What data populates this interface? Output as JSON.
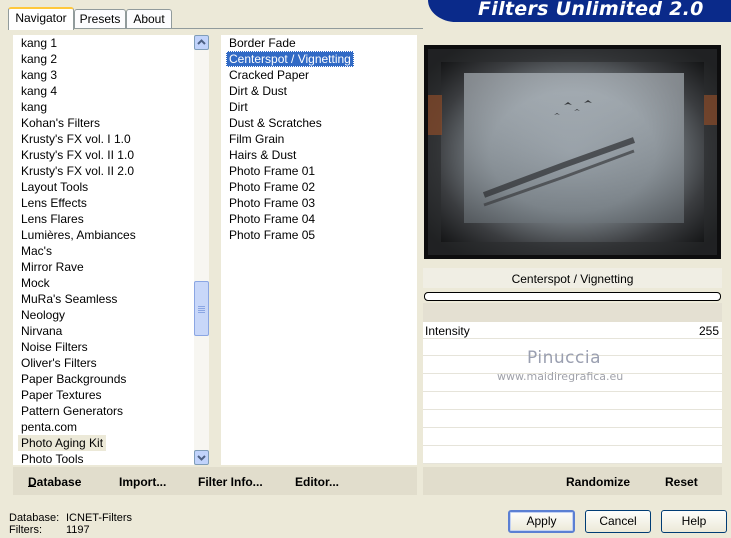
{
  "title": "Filters Unlimited 2.0",
  "tabs": [
    "Navigator",
    "Presets",
    "About"
  ],
  "categories": [
    "kang 1",
    "kang 2",
    "kang 3",
    "kang 4",
    "kang",
    "Kohan's Filters",
    "Krusty's FX vol. I 1.0",
    "Krusty's FX vol. II 1.0",
    "Krusty's FX vol. II 2.0",
    "Layout Tools",
    "Lens Effects",
    "Lens Flares",
    "Lumières, Ambiances",
    "Mac's",
    "Mirror Rave",
    "Mock",
    "MuRa's Seamless",
    "Neology",
    "Nirvana",
    "Noise Filters",
    "Oliver's Filters",
    "Paper Backgrounds",
    "Paper Textures",
    "Pattern Generators",
    "penta.com",
    "Photo Aging Kit",
    "Photo Tools"
  ],
  "selected_category": "Photo Aging Kit",
  "filters": [
    "Border Fade",
    "Centerspot / Vignetting",
    "Cracked Paper",
    "Dirt & Dust",
    "Dirt",
    "Dust & Scratches",
    "Film Grain",
    "Hairs & Dust",
    "Photo Frame 01",
    "Photo Frame 02",
    "Photo Frame 03",
    "Photo Frame 04",
    "Photo Frame 05"
  ],
  "selected_filter": "Centerspot / Vignetting",
  "menu": {
    "database": "Database",
    "import": "Import...",
    "filter_info": "Filter Info...",
    "editor": "Editor..."
  },
  "param_panel": {
    "title": "Centerspot / Vignetting",
    "intensity_label": "Intensity",
    "intensity_value": "255"
  },
  "watermark": {
    "name": "Pinuccia",
    "url": "www.maidiregrafica.eu"
  },
  "actions": {
    "randomize": "Randomize",
    "reset": "Reset"
  },
  "buttons": {
    "apply": "Apply",
    "cancel": "Cancel",
    "help": "Help"
  },
  "status": {
    "database_label": "Database:",
    "database_value": "ICNET-Filters",
    "filters_label": "Filters:",
    "filters_value": "1197"
  },
  "colors": {
    "selection": "#316ac5",
    "banner": "#0a2a8a",
    "face": "#ece9d8"
  }
}
